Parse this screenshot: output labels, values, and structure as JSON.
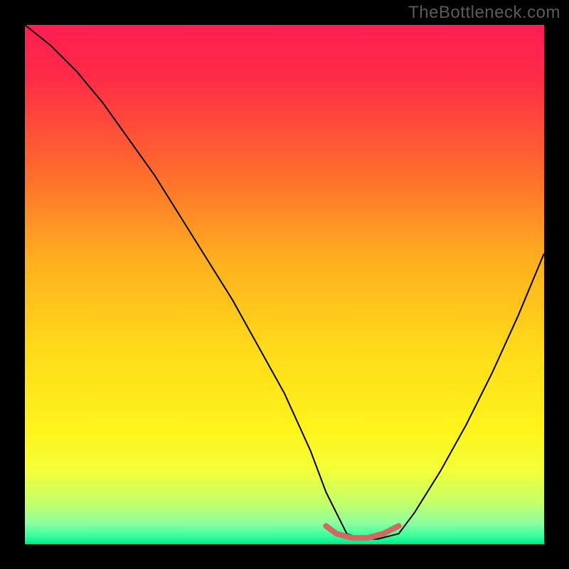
{
  "watermark": "TheBottleneck.com",
  "chart_data": {
    "type": "line",
    "title": "",
    "xlabel": "",
    "ylabel": "",
    "xlim": [
      0,
      100
    ],
    "ylim": [
      0,
      100
    ],
    "gradient_stops": [
      {
        "offset": 0.0,
        "color": "#ff1e52"
      },
      {
        "offset": 0.1,
        "color": "#ff2b47"
      },
      {
        "offset": 0.28,
        "color": "#ff6a2d"
      },
      {
        "offset": 0.45,
        "color": "#ffae1f"
      },
      {
        "offset": 0.62,
        "color": "#ffd91a"
      },
      {
        "offset": 0.78,
        "color": "#fff41b"
      },
      {
        "offset": 0.86,
        "color": "#f2ff3a"
      },
      {
        "offset": 0.92,
        "color": "#c4ff6a"
      },
      {
        "offset": 0.96,
        "color": "#8cffa0"
      },
      {
        "offset": 0.985,
        "color": "#35ff9c"
      },
      {
        "offset": 1.0,
        "color": "#00e887"
      }
    ],
    "series": [
      {
        "name": "bottleneck-curve",
        "color": "#000000",
        "width": 2,
        "x": [
          0,
          5,
          10,
          15,
          20,
          25,
          30,
          35,
          40,
          45,
          50,
          55,
          58,
          62,
          65,
          68,
          72,
          75,
          80,
          85,
          90,
          95,
          100
        ],
        "y": [
          100,
          96,
          91,
          85,
          78,
          71,
          63,
          55,
          47,
          38,
          29,
          18,
          10,
          2,
          1,
          1,
          2,
          6,
          14,
          23,
          33,
          44,
          56
        ]
      },
      {
        "name": "safe-zone-highlight",
        "color": "#cf6a63",
        "width": 8,
        "x": [
          58,
          60,
          63,
          66,
          69,
          72
        ],
        "y": [
          3.5,
          2.0,
          1.2,
          1.2,
          2.0,
          3.5
        ]
      }
    ]
  }
}
